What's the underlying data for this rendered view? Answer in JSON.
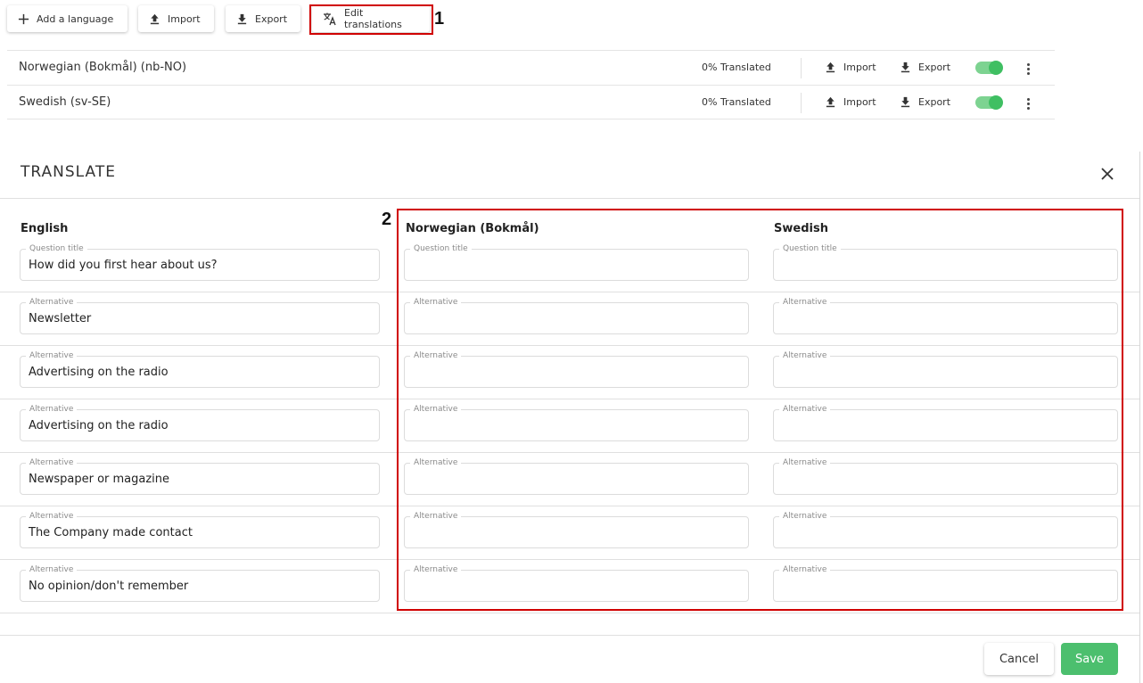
{
  "toolbar": {
    "add_language": "Add a language",
    "import": "Import",
    "export": "Export",
    "edit_translations": "Edit translations"
  },
  "annotations": {
    "marker_1": "1",
    "marker_2": "2",
    "highlight_color": "#d00000"
  },
  "languages": [
    {
      "name": "Norwegian (Bokmål) (nb-NO)",
      "status": "0% Translated",
      "import": "Import",
      "export": "Export",
      "enabled": true
    },
    {
      "name": "Swedish (sv-SE)",
      "status": "0% Translated",
      "import": "Import",
      "export": "Export",
      "enabled": true
    }
  ],
  "dialog": {
    "title": "TRANSLATE",
    "columns": [
      "English",
      "Norwegian (Bokmål)",
      "Swedish"
    ],
    "rows": [
      {
        "label": "Question title",
        "english": "How did you first hear about us?",
        "norwegian": "",
        "swedish": ""
      },
      {
        "label": "Alternative",
        "english": "Newsletter",
        "norwegian": "",
        "swedish": ""
      },
      {
        "label": "Alternative",
        "english": "Advertising on the radio",
        "norwegian": "",
        "swedish": ""
      },
      {
        "label": "Alternative",
        "english": "Advertising on the radio",
        "norwegian": "",
        "swedish": ""
      },
      {
        "label": "Alternative",
        "english": "Newspaper or magazine",
        "norwegian": "",
        "swedish": ""
      },
      {
        "label": "Alternative",
        "english": "The Company made contact",
        "norwegian": "",
        "swedish": ""
      },
      {
        "label": "Alternative",
        "english": "No opinion/don't remember",
        "norwegian": "",
        "swedish": ""
      }
    ],
    "cancel": "Cancel",
    "save": "Save"
  },
  "colors": {
    "accent_green": "#4cbf6e",
    "toggle_on": "#3fbf62"
  },
  "icons": [
    "plus-icon",
    "upload-icon",
    "download-icon",
    "translate-icon",
    "close-icon",
    "more-vert-icon"
  ]
}
